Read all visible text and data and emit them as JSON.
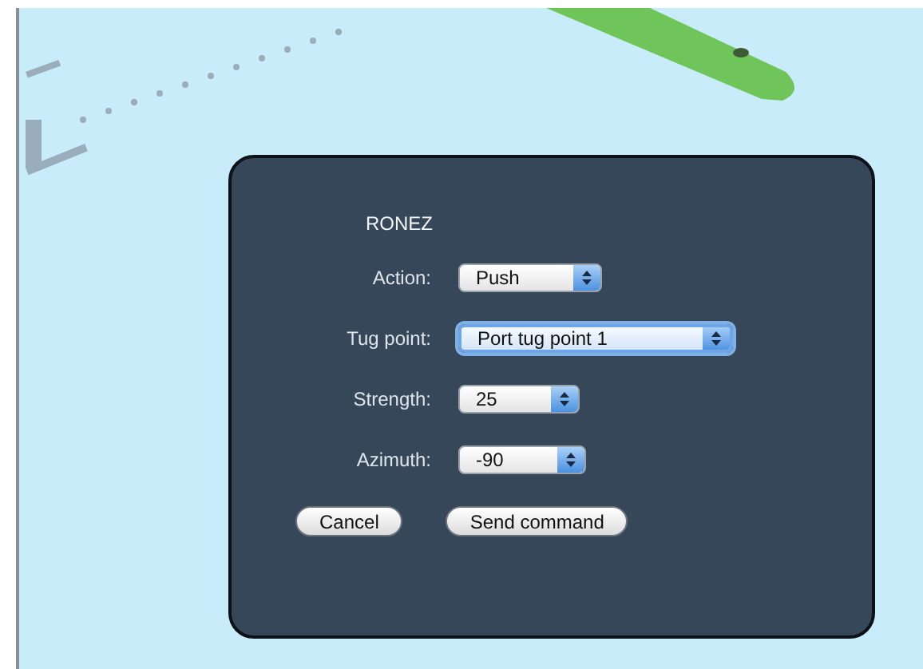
{
  "dialog": {
    "title": "RONEZ",
    "fields": [
      {
        "label": "Action:",
        "value": "Push",
        "focused": false
      },
      {
        "label": "Tug point:",
        "value": "Port tug point 1",
        "focused": true
      },
      {
        "label": "Strength:",
        "value": "25",
        "focused": false
      },
      {
        "label": "Azimuth:",
        "value": "-90",
        "focused": false
      }
    ],
    "buttons": [
      {
        "label": "Cancel"
      },
      {
        "label": "Send command"
      }
    ]
  }
}
